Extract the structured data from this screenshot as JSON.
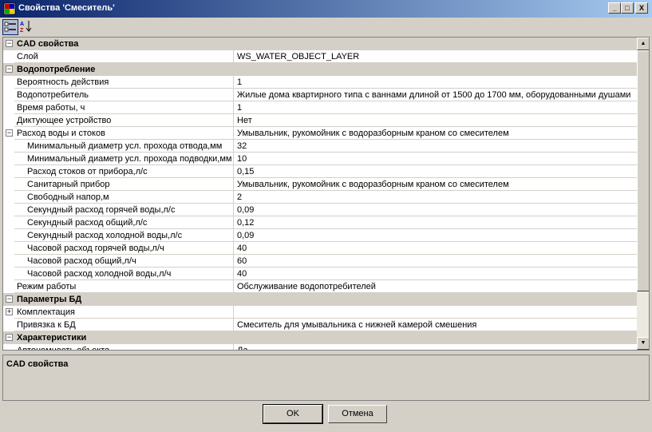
{
  "window": {
    "title": "Свойства 'Смеситель'",
    "controls": {
      "minimize": "_",
      "maximize": "□",
      "close": "X"
    }
  },
  "toolbar": {
    "categorized_icon": "categorized-view-icon",
    "alphabetical_icon": "sort-az-icon"
  },
  "grid": {
    "rows": [
      {
        "kind": "cat",
        "expander": "⊟",
        "name": "CAD свойства"
      },
      {
        "kind": "prop",
        "name": "Слой",
        "value": "WS_WATER_OBJECT_LAYER"
      },
      {
        "kind": "cat",
        "expander": "⊟",
        "name": "Водопотребление"
      },
      {
        "kind": "prop",
        "name": "Вероятность действия",
        "value": "1"
      },
      {
        "kind": "prop",
        "name": "Водопотребитель",
        "value": "Жилые дома квартирного типа с ваннами длиной от 1500 до 1700 мм, оборудованными душами"
      },
      {
        "kind": "prop",
        "name": "Время работы, ч",
        "value": "1"
      },
      {
        "kind": "prop",
        "name": "Диктующее устройство",
        "value": "Нет"
      },
      {
        "kind": "group",
        "expander": "⊟",
        "name": "Расход воды и стоков",
        "value": "Умывальник, рукомойник с водоразборным краном со смесителем"
      },
      {
        "kind": "sub",
        "name": "Минимальный диаметр усл. прохода отвода,мм",
        "value": "32"
      },
      {
        "kind": "sub",
        "name": "Минимальный диаметр усл. прохода подводки,мм",
        "value": "10"
      },
      {
        "kind": "sub",
        "name": "Расход стоков от прибора,л/с",
        "value": "0,15"
      },
      {
        "kind": "sub",
        "name": "Санитарный прибор",
        "value": "Умывальник, рукомойник с водоразборным краном со смесителем"
      },
      {
        "kind": "sub",
        "name": "Свободный напор,м",
        "value": "2"
      },
      {
        "kind": "sub",
        "name": "Секундный расход горячей воды,л/с",
        "value": "0,09"
      },
      {
        "kind": "sub",
        "name": "Секундный расход общий,л/с",
        "value": "0,12"
      },
      {
        "kind": "sub",
        "name": "Секундный расход холодной воды,л/с",
        "value": "0,09"
      },
      {
        "kind": "sub",
        "name": "Часовой расход горячей воды,л/ч",
        "value": "40"
      },
      {
        "kind": "sub",
        "name": "Часовой расход общий,л/ч",
        "value": "60"
      },
      {
        "kind": "sub",
        "name": "Часовой расход холодной воды,л/ч",
        "value": "40"
      },
      {
        "kind": "prop",
        "name": "Режим работы",
        "value": "Обслуживание водопотребителей"
      },
      {
        "kind": "cat",
        "expander": "⊟",
        "name": "Параметры БД"
      },
      {
        "kind": "group",
        "expander": "⊞",
        "name": "Комплектация",
        "value": ""
      },
      {
        "kind": "prop",
        "name": "Привязка к БД",
        "value": "Смеситель для умывальника с нижней камерой смешения"
      },
      {
        "kind": "cat",
        "expander": "⊟",
        "name": "Характеристики"
      },
      {
        "kind": "prop",
        "name": "Автономность объекта",
        "value": "Да"
      }
    ]
  },
  "description": {
    "title": "CAD свойства"
  },
  "buttons": {
    "ok": "OK",
    "cancel": "Отмена"
  }
}
